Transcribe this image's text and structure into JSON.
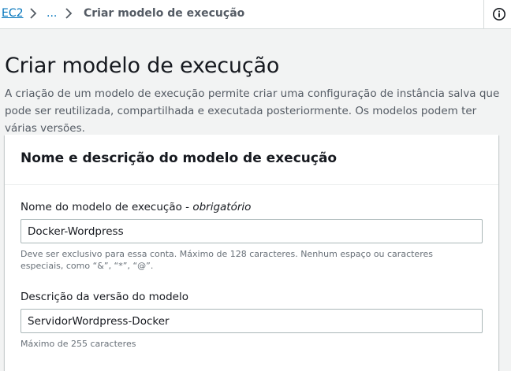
{
  "breadcrumb": {
    "root_label": "EC2",
    "ellipsis_label": "...",
    "current_label": "Criar modelo de execução"
  },
  "header": {
    "title": "Criar modelo de execução",
    "description": "A criação de um modelo de execução permite criar uma configuração de instância salva que pode ser reutilizada, compartilhada e executada posteriormente. Os modelos podem ter várias versões."
  },
  "panel": {
    "title": "Nome e descrição do modelo de execução",
    "name_field": {
      "label": "Nome do modelo de execução - ",
      "required_label": "obrigatório",
      "value": "Docker-Wordpress",
      "constraint": "Deve ser exclusivo para essa conta. Máximo de 128 caracteres. Nenhum espaço ou caracteres especiais, como “&”, “*”, “@”."
    },
    "description_field": {
      "label": "Descrição da versão do modelo",
      "value": "ServidorWordpress-Docker",
      "constraint": "Máximo de 255 caracteres"
    }
  },
  "icons": {
    "separator": "chevron-right-icon",
    "info": "info-icon"
  },
  "colors": {
    "link": "#0073bb",
    "page_background": "#f2f3f3",
    "panel_background": "#ffffff",
    "text": "#16191f",
    "secondary_text": "#545b64"
  }
}
